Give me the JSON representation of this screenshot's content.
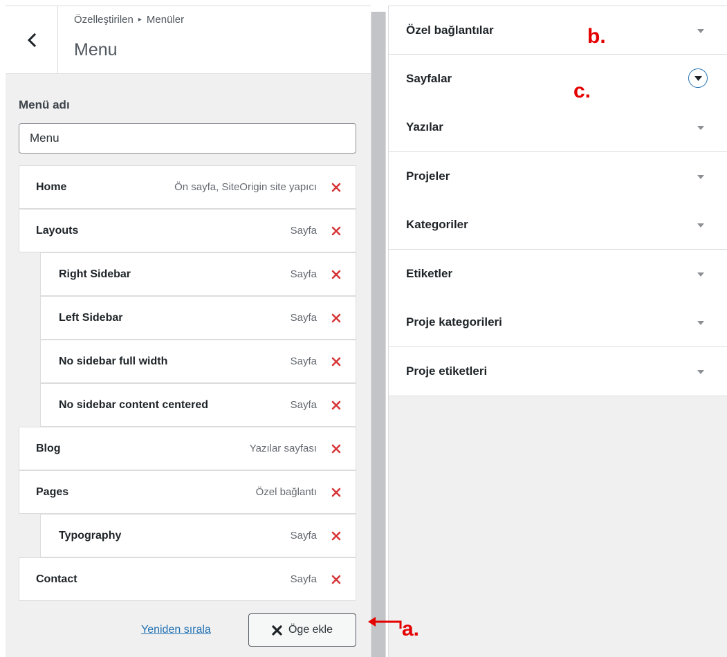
{
  "header": {
    "breadcrumb_parent": "Özelleştirilen",
    "breadcrumb_sep": "▸",
    "breadcrumb_current": "Menüler",
    "title": "Menu"
  },
  "menu_name": {
    "label": "Menü adı",
    "value": "Menu"
  },
  "menu_items": [
    {
      "title": "Home",
      "type": "Ön sayfa, SiteOrigin site yapıcı",
      "depth": 0
    },
    {
      "title": "Layouts",
      "type": "Sayfa",
      "depth": 0
    },
    {
      "title": "Right Sidebar",
      "type": "Sayfa",
      "depth": 1
    },
    {
      "title": "Left Sidebar",
      "type": "Sayfa",
      "depth": 1
    },
    {
      "title": "No sidebar full width",
      "type": "Sayfa",
      "depth": 1
    },
    {
      "title": "No sidebar content centered",
      "type": "Sayfa",
      "depth": 1
    },
    {
      "title": "Blog",
      "type": "Yazılar sayfası",
      "depth": 0
    },
    {
      "title": "Pages",
      "type": "Özel bağlantı",
      "depth": 0
    },
    {
      "title": "Typography",
      "type": "Sayfa",
      "depth": 1
    },
    {
      "title": "Contact",
      "type": "Sayfa",
      "depth": 0
    }
  ],
  "actions": {
    "reorder_label": "Yeniden sırala",
    "add_item_label": "Öge ekle"
  },
  "sections": [
    {
      "label": "Özel bağlantılar",
      "focused": false
    },
    {
      "label": "Sayfalar",
      "focused": true
    },
    {
      "label": "Yazılar",
      "focused": false
    },
    {
      "label": "Projeler",
      "focused": false
    },
    {
      "label": "Kategoriler",
      "focused": false
    },
    {
      "label": "Etiketler",
      "focused": false
    },
    {
      "label": "Proje kategorileri",
      "focused": false
    },
    {
      "label": "Proje etiketleri",
      "focused": false
    }
  ],
  "annotations": {
    "a": "a.",
    "b": "b.",
    "c": "c."
  },
  "colors": {
    "link": "#2271b1",
    "delete": "#d63638",
    "annotation": "#e50000"
  }
}
